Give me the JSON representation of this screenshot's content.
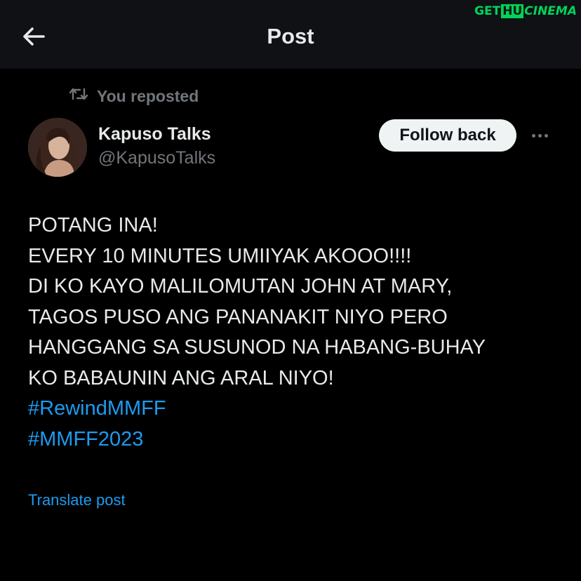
{
  "header": {
    "title": "Post",
    "back_icon": "arrow-left-icon"
  },
  "watermark": {
    "part1": "GET",
    "part2": "HU",
    "part3": "CINEMA"
  },
  "repost": {
    "icon": "repost-icon",
    "label": "You reposted"
  },
  "author": {
    "name": "Kapuso Talks",
    "handle": "@KapusoTalks",
    "avatar_icon": "profile-photo"
  },
  "follow_button": {
    "label": "Follow back"
  },
  "more_icon": "more-horizontal-icon",
  "post": {
    "lines": [
      "POTANG INA!",
      "EVERY 10 MINUTES UMIIYAK AKOOO!!!!",
      "DI KO KAYO MALILOMUTAN JOHN AT MARY,",
      "TAGOS PUSO ANG PANANAKIT NIYO PERO",
      "HANGGANG SA SUSUNOD NA HABANG-BUHAY",
      "KO BABAUNIN ANG ARAL NIYO!"
    ],
    "hashtags": [
      "#RewindMMFF",
      "#MMFF2023"
    ]
  },
  "translate_link": "Translate post",
  "colors": {
    "background": "#000000",
    "header_bg": "#0f1114",
    "text": "#e7e9ea",
    "muted": "#71767b",
    "link": "#1d9bf0",
    "button_bg": "#eff3f4",
    "watermark": "#00d45a"
  }
}
